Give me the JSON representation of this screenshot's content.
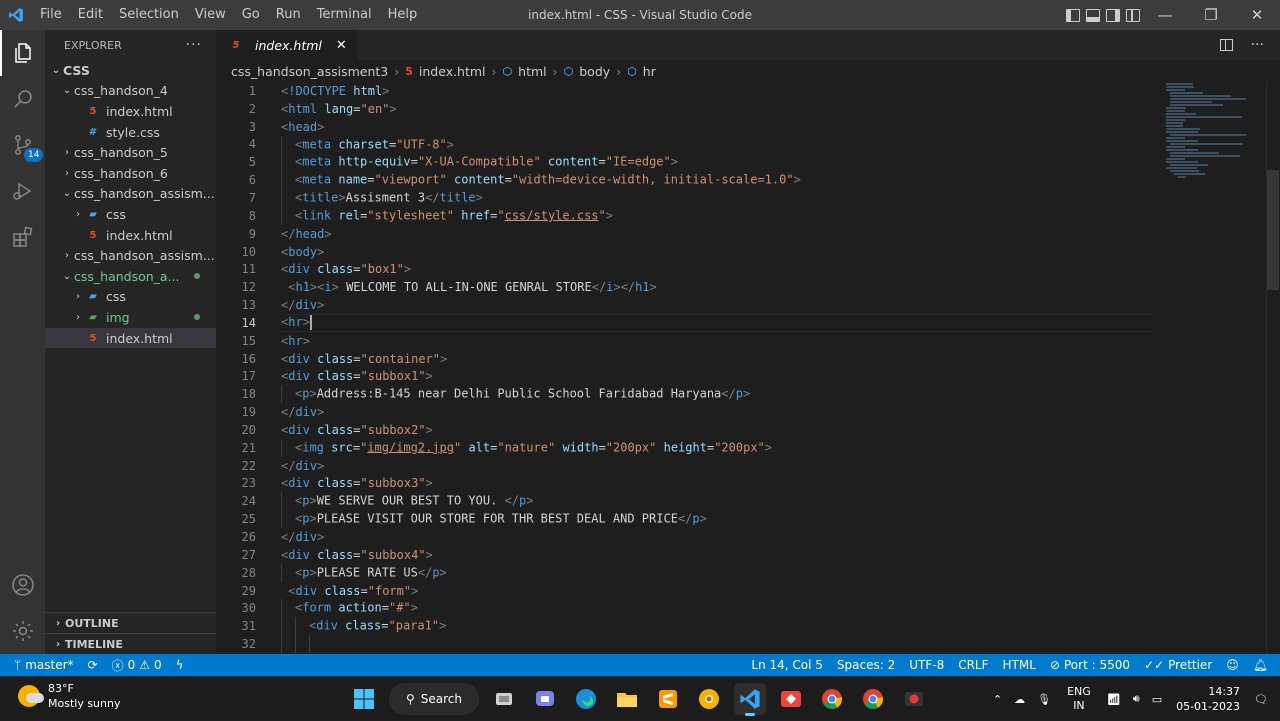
{
  "window": {
    "title": "index.html - CSS - Visual Studio Code"
  },
  "menu": [
    "File",
    "Edit",
    "Selection",
    "View",
    "Go",
    "Run",
    "Terminal",
    "Help"
  ],
  "explorer": {
    "header": "EXPLORER",
    "root": "CSS",
    "items": [
      {
        "label": "css_handson_4",
        "type": "folder",
        "open": true,
        "depth": 1
      },
      {
        "label": "index.html",
        "type": "html",
        "depth": 2
      },
      {
        "label": "style.css",
        "type": "css",
        "depth": 2
      },
      {
        "label": "css_handson_5",
        "type": "folder",
        "open": false,
        "depth": 1
      },
      {
        "label": "css_handson_6",
        "type": "folder",
        "open": false,
        "depth": 1
      },
      {
        "label": "css_handson_assism...",
        "type": "folder",
        "open": true,
        "depth": 1
      },
      {
        "label": "css",
        "type": "cssfolder",
        "open": false,
        "depth": 2
      },
      {
        "label": "index.html",
        "type": "html",
        "depth": 2
      },
      {
        "label": "css_handson_assism...",
        "type": "folder",
        "open": false,
        "depth": 1
      },
      {
        "label": "css_handson_a...",
        "type": "folder",
        "open": true,
        "depth": 1,
        "modified": true
      },
      {
        "label": "css",
        "type": "cssfolder",
        "open": false,
        "depth": 2
      },
      {
        "label": "img",
        "type": "imgfolder",
        "open": false,
        "depth": 2,
        "modified": true
      },
      {
        "label": "index.html",
        "type": "html",
        "depth": 2,
        "selected": true
      }
    ],
    "outline": "OUTLINE",
    "timeline": "TIMELINE"
  },
  "tab": {
    "label": "index.html",
    "close": "✕"
  },
  "breadcrumb": {
    "folder": "css_handson_assisment3",
    "file": "index.html",
    "n1": "html",
    "n2": "body",
    "n3": "hr"
  },
  "source_control_badge": "14",
  "code_lines": [
    {
      "n": 1,
      "indent": 0,
      "html": "<span class='tg'>&lt;</span><span class='tn'>!DOCTYPE</span> <span class='at'>html</span><span class='tg'>&gt;</span>"
    },
    {
      "n": 2,
      "indent": 0,
      "html": "<span class='tg'>&lt;</span><span class='tn'>html</span> <span class='at'>lang</span><span class='tx'>=</span><span class='av'>\"en\"</span><span class='tg'>&gt;</span>"
    },
    {
      "n": 3,
      "indent": 0,
      "html": "<span class='tg'>&lt;</span><span class='tn'>head</span><span class='tg'>&gt;</span>"
    },
    {
      "n": 4,
      "indent": 1,
      "html": "<span class='tg'>&lt;</span><span class='tn'>meta</span> <span class='at'>charset</span><span class='tx'>=</span><span class='av'>\"UTF-8\"</span><span class='tg'>&gt;</span>"
    },
    {
      "n": 5,
      "indent": 1,
      "html": "<span class='tg'>&lt;</span><span class='tn'>meta</span> <span class='at'>http-equiv</span><span class='tx'>=</span><span class='av'>\"X-UA-Compatible\"</span> <span class='at'>content</span><span class='tx'>=</span><span class='av'>\"IE=edge\"</span><span class='tg'>&gt;</span>"
    },
    {
      "n": 6,
      "indent": 1,
      "html": "<span class='tg'>&lt;</span><span class='tn'>meta</span> <span class='at'>name</span><span class='tx'>=</span><span class='av'>\"viewport\"</span> <span class='at'>content</span><span class='tx'>=</span><span class='av'>\"width=device-width, initial-scale=1.0\"</span><span class='tg'>&gt;</span>"
    },
    {
      "n": 7,
      "indent": 1,
      "html": "<span class='tg'>&lt;</span><span class='tn'>title</span><span class='tg'>&gt;</span><span class='tx'>Assisment 3</span><span class='tg'>&lt;/</span><span class='tn'>title</span><span class='tg'>&gt;</span>"
    },
    {
      "n": 8,
      "indent": 1,
      "html": "<span class='tg'>&lt;</span><span class='tn'>link</span> <span class='at'>rel</span><span class='tx'>=</span><span class='av'>\"stylesheet\"</span> <span class='at'>href</span><span class='tx'>=</span><span class='av'>\"<span class='ul'>css/style.css</span>\"</span><span class='tg'>&gt;</span>"
    },
    {
      "n": 9,
      "indent": 0,
      "html": "<span class='tg'>&lt;/</span><span class='tn'>head</span><span class='tg'>&gt;</span>"
    },
    {
      "n": 10,
      "indent": 0,
      "html": "<span class='tg'>&lt;</span><span class='tn'>body</span><span class='tg'>&gt;</span>"
    },
    {
      "n": 11,
      "indent": 0,
      "html": "<span class='tg'>&lt;</span><span class='tn'>div</span> <span class='at'>class</span><span class='tx'>=</span><span class='av'>\"box1\"</span><span class='tg'>&gt;</span>"
    },
    {
      "n": 12,
      "indent": 0,
      "html": " <span class='tg'>&lt;</span><span class='tn'>h1</span><span class='tg'>&gt;&lt;</span><span class='tn'>i</span><span class='tg'>&gt;</span><span class='tx'> WELCOME TO ALL-IN-ONE GENRAL STORE</span><span class='tg'>&lt;/</span><span class='tn'>i</span><span class='tg'>&gt;&lt;/</span><span class='tn'>h1</span><span class='tg'>&gt;</span>"
    },
    {
      "n": 13,
      "indent": 0,
      "html": "<span class='tg'>&lt;/</span><span class='tn'>div</span><span class='tg'>&gt;</span>"
    },
    {
      "n": 14,
      "indent": 0,
      "html": "<span class='tg'>&lt;</span><span class='tn'>hr</span><span class='tg'>&gt;</span><span class='cursor'></span>",
      "current": true
    },
    {
      "n": 15,
      "indent": 0,
      "html": "<span class='tg'>&lt;</span><span class='tn'>hr</span><span class='tg'>&gt;</span>"
    },
    {
      "n": 16,
      "indent": 0,
      "html": "<span class='tg'>&lt;</span><span class='tn'>div</span> <span class='at'>class</span><span class='tx'>=</span><span class='av'>\"container\"</span><span class='tg'>&gt;</span>"
    },
    {
      "n": 17,
      "indent": 0,
      "html": "<span class='tg'>&lt;</span><span class='tn'>div</span> <span class='at'>class</span><span class='tx'>=</span><span class='av'>\"subbox1\"</span><span class='tg'>&gt;</span>"
    },
    {
      "n": 18,
      "indent": 1,
      "html": "<span class='tg'>&lt;</span><span class='tn'>p</span><span class='tg'>&gt;</span><span class='tx'>Address:B-145 near Delhi Public School Faridabad Haryana</span><span class='tg'>&lt;/</span><span class='tn'>p</span><span class='tg'>&gt;</span>"
    },
    {
      "n": 19,
      "indent": 0,
      "html": "<span class='tg'>&lt;/</span><span class='tn'>div</span><span class='tg'>&gt;</span>"
    },
    {
      "n": 20,
      "indent": 0,
      "html": "<span class='tg'>&lt;</span><span class='tn'>div</span> <span class='at'>class</span><span class='tx'>=</span><span class='av'>\"subbox2\"</span><span class='tg'>&gt;</span>"
    },
    {
      "n": 21,
      "indent": 1,
      "html": "<span class='tg'>&lt;</span><span class='tn'>img</span> <span class='at'>src</span><span class='tx'>=</span><span class='av'>\"<span class='ul'>img/img2.jpg</span>\"</span> <span class='at'>alt</span><span class='tx'>=</span><span class='av'>\"nature\"</span> <span class='at'>width</span><span class='tx'>=</span><span class='av'>\"200px\"</span> <span class='at'>height</span><span class='tx'>=</span><span class='av'>\"200px\"</span><span class='tg'>&gt;</span>"
    },
    {
      "n": 22,
      "indent": 0,
      "html": "<span class='tg'>&lt;/</span><span class='tn'>div</span><span class='tg'>&gt;</span>"
    },
    {
      "n": 23,
      "indent": 0,
      "html": "<span class='tg'>&lt;</span><span class='tn'>div</span> <span class='at'>class</span><span class='tx'>=</span><span class='av'>\"subbox3\"</span><span class='tg'>&gt;</span>"
    },
    {
      "n": 24,
      "indent": 1,
      "html": "<span class='tg'>&lt;</span><span class='tn'>p</span><span class='tg'>&gt;</span><span class='tx'>WE SERVE OUR BEST TO YOU. </span><span class='tg'>&lt;/</span><span class='tn'>p</span><span class='tg'>&gt;</span>"
    },
    {
      "n": 25,
      "indent": 1,
      "html": "<span class='tg'>&lt;</span><span class='tn'>p</span><span class='tg'>&gt;</span><span class='tx'>PLEASE VISIT OUR STORE FOR THR BEST DEAL AND PRICE</span><span class='tg'>&lt;/</span><span class='tn'>p</span><span class='tg'>&gt;</span>"
    },
    {
      "n": 26,
      "indent": 0,
      "html": "<span class='tg'>&lt;/</span><span class='tn'>div</span><span class='tg'>&gt;</span>"
    },
    {
      "n": 27,
      "indent": 0,
      "html": "<span class='tg'>&lt;</span><span class='tn'>div</span> <span class='at'>class</span><span class='tx'>=</span><span class='av'>\"subbox4\"</span><span class='tg'>&gt;</span>"
    },
    {
      "n": 28,
      "indent": 1,
      "html": "<span class='tg'>&lt;</span><span class='tn'>p</span><span class='tg'>&gt;</span><span class='tx'>PLEASE RATE US</span><span class='tg'>&lt;/</span><span class='tn'>p</span><span class='tg'>&gt;</span>"
    },
    {
      "n": 29,
      "indent": 0,
      "html": " <span class='tg'>&lt;</span><span class='tn'>div</span> <span class='at'>class</span><span class='tx'>=</span><span class='av'>\"form\"</span><span class='tg'>&gt;</span>"
    },
    {
      "n": 30,
      "indent": 1,
      "html": "<span class='tg'>&lt;</span><span class='tn'>form</span> <span class='at'>action</span><span class='tx'>=</span><span class='av'>\"#\"</span><span class='tg'>&gt;</span>"
    },
    {
      "n": 31,
      "indent": 2,
      "html": "<span class='tg'>&lt;</span><span class='tn'>div</span> <span class='at'>class</span><span class='tx'>=</span><span class='av'>\"para1\"</span><span class='tg'>&gt;</span>"
    },
    {
      "n": 32,
      "indent": 3,
      "html": ""
    }
  ],
  "status": {
    "branch": "master*",
    "errors": "0",
    "warnings": "0",
    "position": "Ln 14, Col 5",
    "spaces": "Spaces: 2",
    "encoding": "UTF-8",
    "eol": "CRLF",
    "language": "HTML",
    "port": "Port : 5500",
    "prettier": "Prettier"
  },
  "taskbar": {
    "temp": "83°F",
    "weather": "Mostly sunny",
    "search": "Search",
    "lang1": "ENG",
    "lang2": "IN",
    "time": "14:37",
    "date": "05-01-2023"
  },
  "colors": {
    "accent": "#007acc",
    "titlebar": "#3c3c3c",
    "sidebar": "#252526",
    "editor": "#1e1e1e"
  }
}
